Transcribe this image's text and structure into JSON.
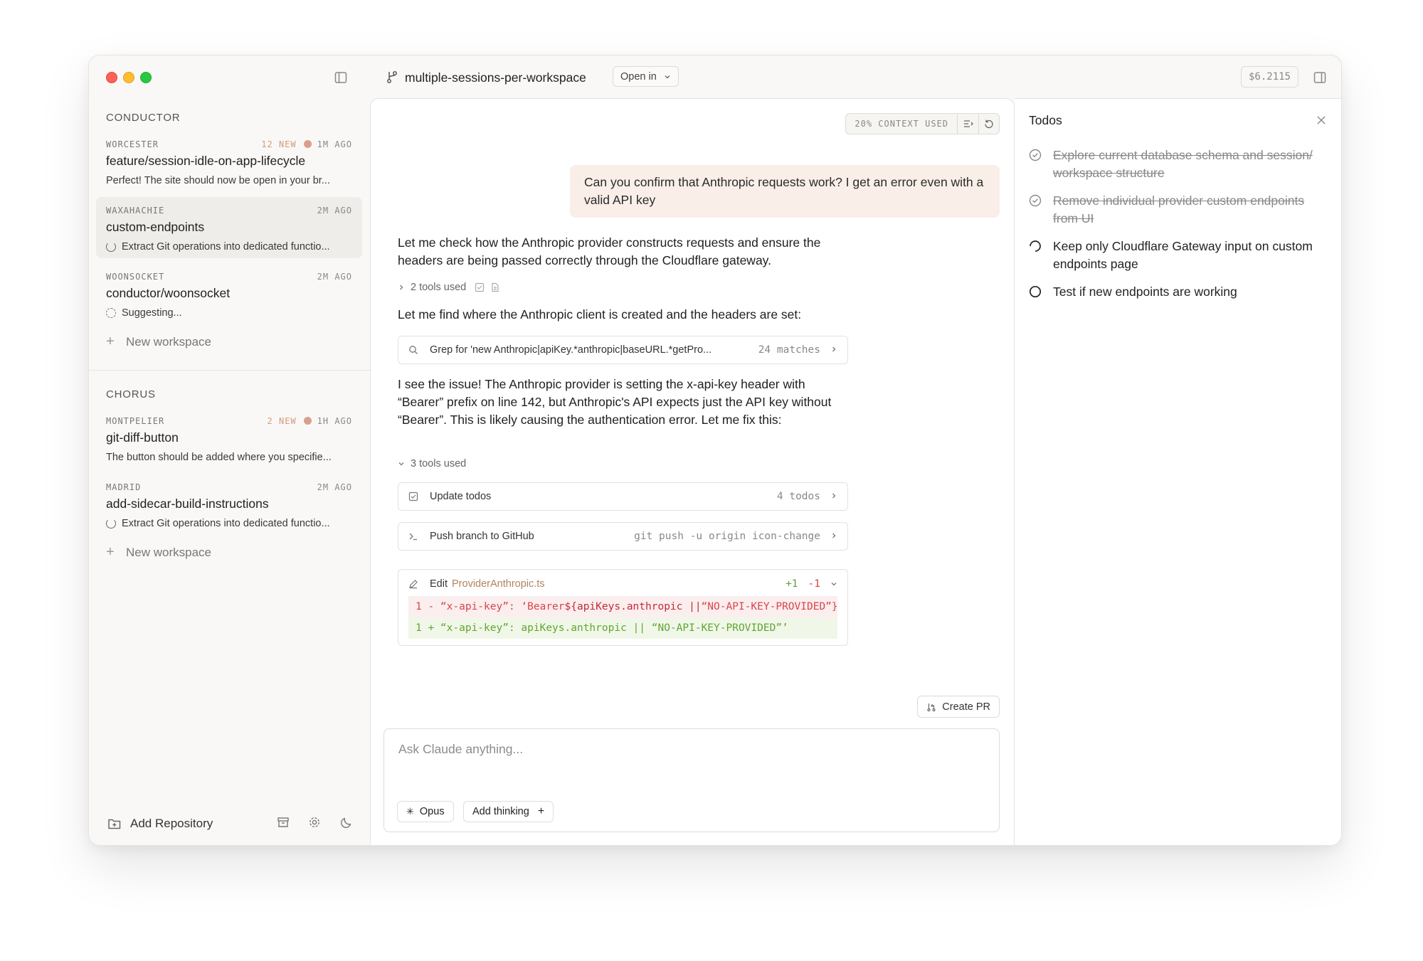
{
  "header": {
    "branch": "multiple-sessions-per-workspace",
    "open_in_label": "Open in",
    "cost": "$6.2115"
  },
  "sidebar": {
    "groups": [
      {
        "title": "CONDUCTOR",
        "workspaces": [
          {
            "location": "WORCESTER",
            "new": "12 NEW",
            "time": "1M AGO",
            "name": "feature/session-idle-on-app-lifecycle",
            "subtitle": "Perfect! The site should now be open in your br..."
          },
          {
            "location": "WAXAHACHIE",
            "time": "2M AGO",
            "name": "custom-endpoints",
            "subtitle": "Extract Git operations into dedicated functio..."
          },
          {
            "location": "WOONSOCKET",
            "time": "2M AGO",
            "name": "conductor/woonsocket",
            "subtitle": "Suggesting..."
          }
        ],
        "new_workspace": "New workspace"
      },
      {
        "title": "CHORUS",
        "workspaces": [
          {
            "location": "MONTPELIER",
            "new": "2 NEW",
            "time": "1H AGO",
            "name": "git-diff-button",
            "subtitle": "The button should be added where you specifie..."
          },
          {
            "location": "MADRID",
            "time": "2M AGO",
            "name": "add-sidecar-build-instructions",
            "subtitle": "Extract Git operations into dedicated functio..."
          }
        ],
        "new_workspace": "New workspace"
      }
    ],
    "add_repository": "Add Repository"
  },
  "chat": {
    "context_used": "20% CONTEXT USED",
    "user_message": "Can you confirm that Anthropic requests work? I get an error even with a valid API key",
    "assistant_1": "Let me check how the Anthropic provider constructs requests and ensure the headers are being passed correctly through the Cloudflare gateway.",
    "tools_used_1": "2 tools used",
    "assistant_2": "Let me find where the Anthropic client is created and the headers are set:",
    "grep_title": "Grep for 'new Anthropic|apiKey.*anthropic|baseURL.*getPro...",
    "grep_meta": "24 matches",
    "assistant_3": "I see the issue! The Anthropic provider is setting the x-api-key header with “Bearer” prefix on line 142, but Anthropic's API expects just the API key without “Bearer”. This is likely causing the authentication error. Let me fix this:",
    "tools_used_2": "3 tools used",
    "update_todos_title": "Update todos",
    "update_todos_meta": "4 todos",
    "push_title": "Push branch to GitHub",
    "push_meta": "git push -u origin icon-change",
    "edit_label": "Edit",
    "edit_file": "ProviderAnthropic.ts",
    "edit_plus": "+1",
    "edit_minus": "-1",
    "diff_del_prefix": "1 - “x-api-key”: ‘Bearer ",
    "diff_del_hl": "${apiKeys.anthropic ||",
    "diff_del_suffix": " “NO-API-KEY-PROVIDED”}’",
    "diff_add": "1 + “x-api-key”: apiKeys.anthropic || “NO-API-KEY-PROVIDED”’",
    "create_pr": "Create PR",
    "composer_placeholder": "Ask Claude anything...",
    "model": "Opus",
    "add_thinking": "Add thinking"
  },
  "todos": {
    "title": "Todos",
    "items": [
      {
        "text": "Explore current database schema and session/ workspace structure",
        "status": "done"
      },
      {
        "text": "Remove individual provider custom endpoints from UI",
        "status": "done"
      },
      {
        "text": "Keep only Cloudflare Gateway input on custom endpoints page",
        "status": "in-progress"
      },
      {
        "text": "Test if new endpoints are working",
        "status": "pending"
      }
    ]
  }
}
